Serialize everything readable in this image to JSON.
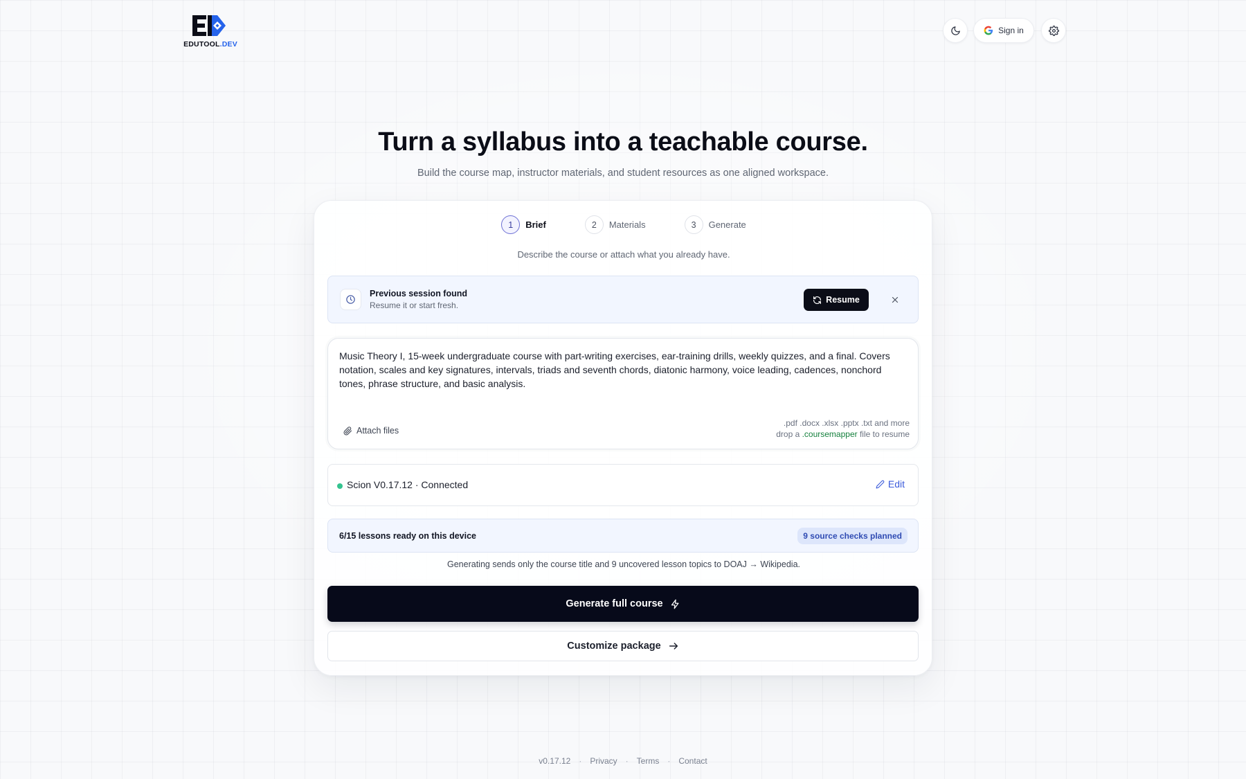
{
  "header": {
    "logo_text_main": "EDUTOOL",
    "logo_text_accent": ".DEV",
    "sign_in_label": "Sign in",
    "theme_icon": "moon-icon",
    "google_icon": "google-icon",
    "settings_icon": "gear-icon"
  },
  "hero": {
    "title": "Turn a syllabus into a teachable course.",
    "subtitle": "Build the course map, instructor materials, and student resources as one aligned workspace."
  },
  "steps": [
    {
      "number": "1",
      "label": "Brief",
      "active": true
    },
    {
      "number": "2",
      "label": "Materials",
      "active": false
    },
    {
      "number": "3",
      "label": "Generate",
      "active": false
    }
  ],
  "card": {
    "description": "Describe the course or attach what you already have."
  },
  "session": {
    "title": "Previous session found",
    "subtitle": "Resume it or start fresh.",
    "resume_label": "Resume"
  },
  "brief": {
    "value": "Music Theory I, 15-week undergraduate course with part-writing exercises, ear-training drills, weekly quizzes, and a final. Covers notation, scales and key signatures, intervals, triads and seventh chords, diatonic harmony, voice leading, cadences, nonchord tones, phrase structure, and basic analysis.",
    "attach_label": "Attach files",
    "file_types": ".pdf .docx .xlsx .pptx .txt and more",
    "resume_hint_prefix": "drop a ",
    "resume_hint_ext": ".coursemapper",
    "resume_hint_suffix": " file to resume"
  },
  "connection": {
    "label": "Scion V0.17.12 · Connected",
    "status_color": "#34c38f",
    "edit_label": "Edit"
  },
  "lessons": {
    "label": "6/15 lessons ready on this device",
    "badge": "9 source checks planned"
  },
  "privacy_note": "Generating sends only the course title and 9 uncovered lesson topics to DOAJ → Wikipedia.",
  "actions": {
    "generate_label": "Generate full course",
    "customize_label": "Customize package"
  },
  "footer": {
    "version": "v0.17.12",
    "separator": "·",
    "links": [
      "Privacy",
      "Terms",
      "Contact"
    ]
  },
  "colors": {
    "primary_dark": "#070a1a",
    "accent_blue": "#2563eb",
    "link_blue": "#3b5bdb",
    "success_green": "#34c38f"
  }
}
